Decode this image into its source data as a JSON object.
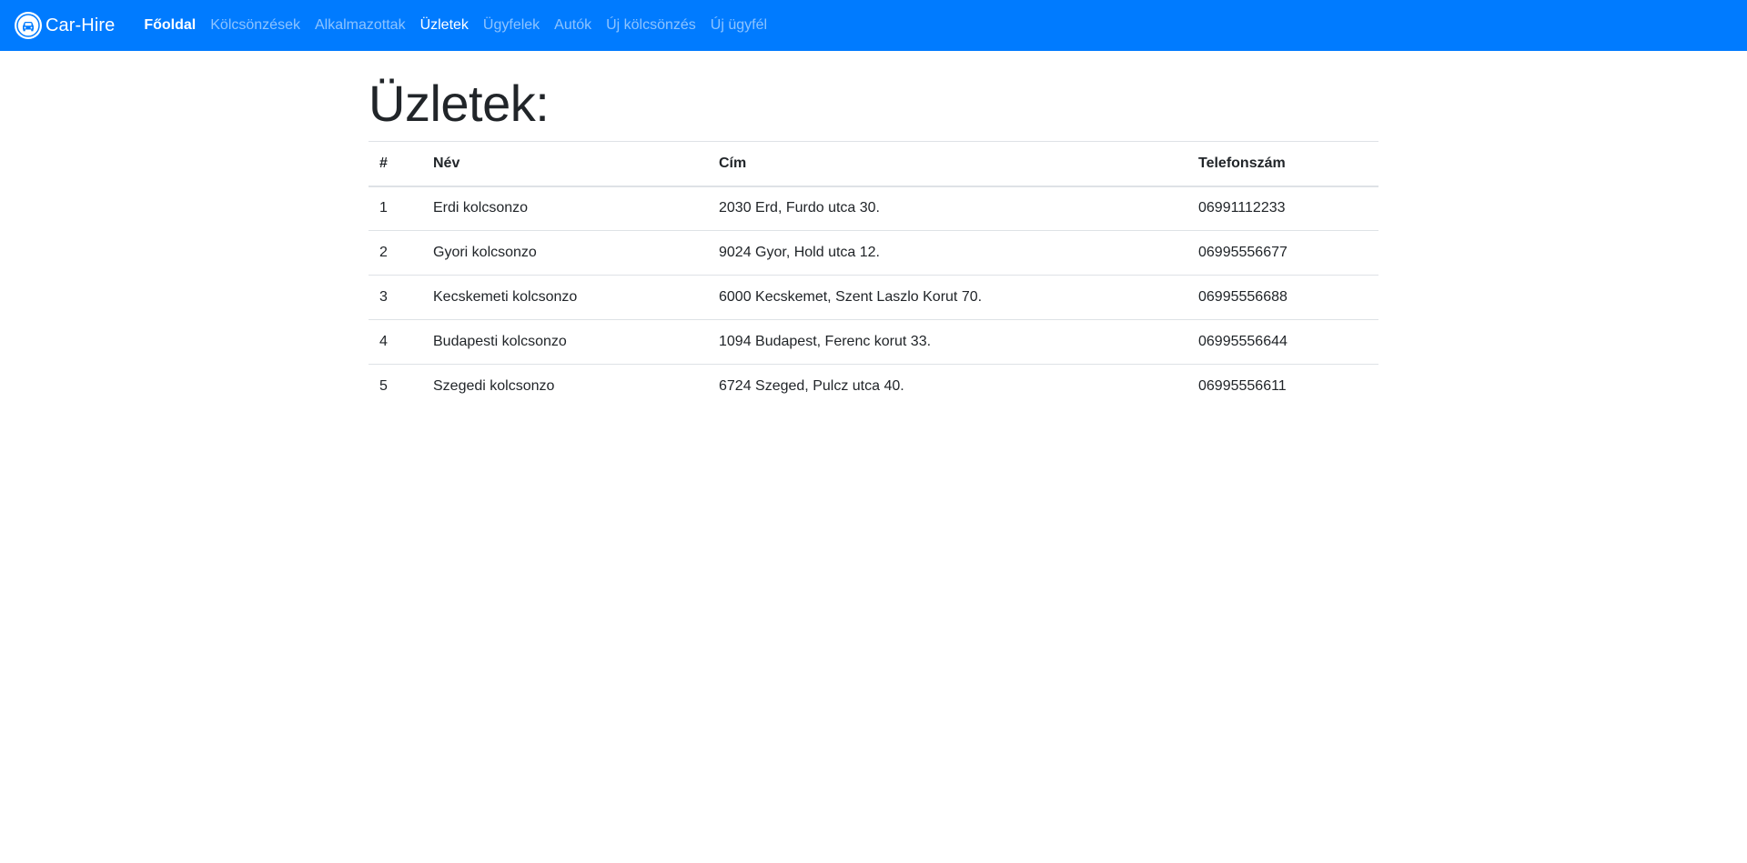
{
  "navbar": {
    "brand_icon": "car-logo-icon",
    "brand": "Car-Hire",
    "items": [
      {
        "label": "Főoldal",
        "state": "bold"
      },
      {
        "label": "Kölcsönzések",
        "state": "normal"
      },
      {
        "label": "Alkalmazottak",
        "state": "normal"
      },
      {
        "label": "Üzletek",
        "state": "active"
      },
      {
        "label": "Ügyfelek",
        "state": "normal"
      },
      {
        "label": "Autók",
        "state": "normal"
      },
      {
        "label": "Új kölcsönzés",
        "state": "normal"
      },
      {
        "label": "Új ügyfél",
        "state": "normal"
      }
    ],
    "background_color": "#007bff"
  },
  "page": {
    "title": "Üzletek:"
  },
  "table": {
    "headers": [
      "#",
      "Név",
      "Cím",
      "Telefonszám"
    ],
    "rows": [
      [
        "1",
        "Erdi kolcsonzo",
        "2030 Erd, Furdo utca 30.",
        "06991112233"
      ],
      [
        "2",
        "Gyori kolcsonzo",
        "9024 Gyor, Hold utca 12.",
        "06995556677"
      ],
      [
        "3",
        "Kecskemeti kolcsonzo",
        "6000 Kecskemet, Szent Laszlo Korut 70.",
        "06995556688"
      ],
      [
        "4",
        "Budapesti kolcsonzo",
        "1094 Budapest, Ferenc korut 33.",
        "06995556644"
      ],
      [
        "5",
        "Szegedi kolcsonzo",
        "6724 Szeged, Pulcz utca 40.",
        "06995556611"
      ]
    ]
  }
}
